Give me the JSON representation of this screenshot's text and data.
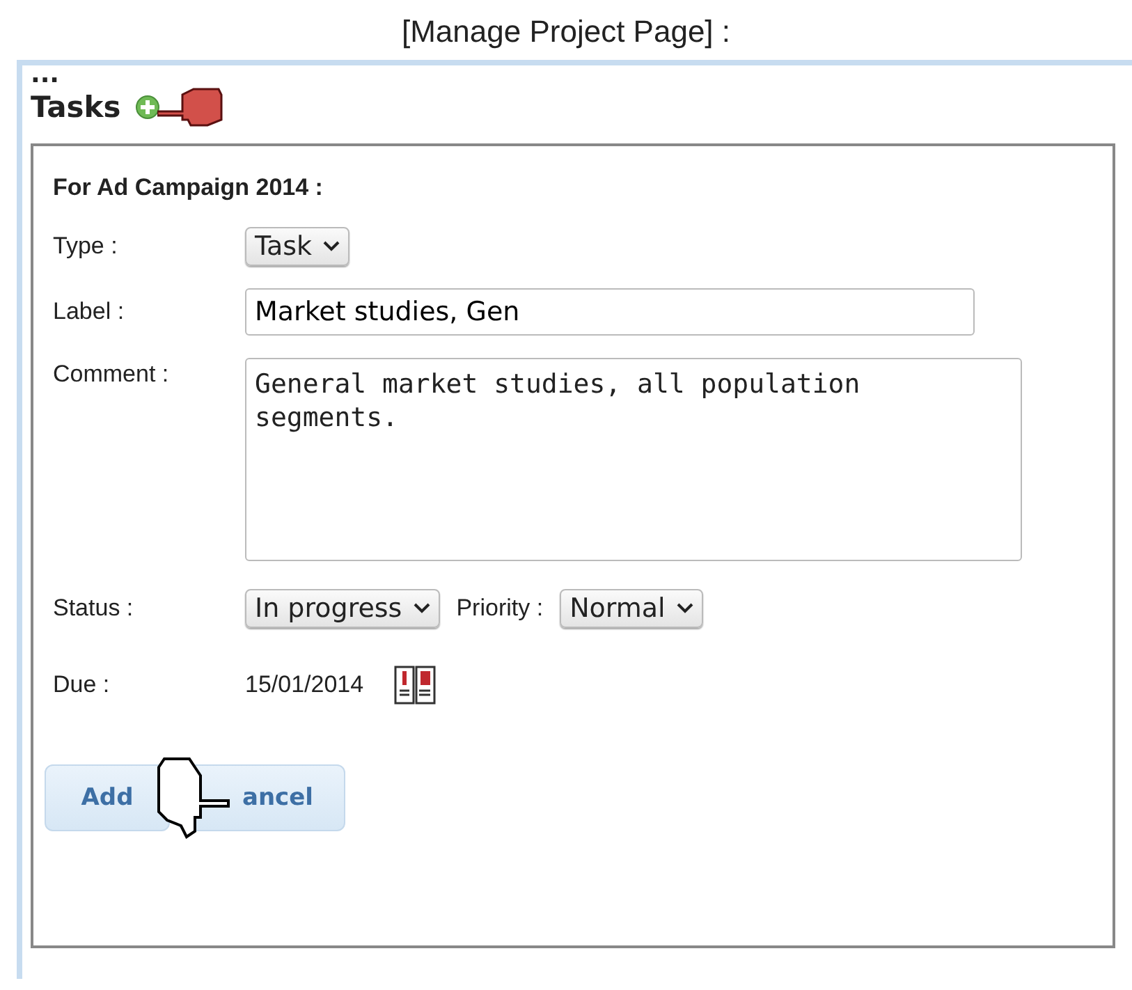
{
  "page_title": "[Manage Project Page] :",
  "ellipsis": "...",
  "section": {
    "title": "Tasks"
  },
  "form": {
    "heading": "For Ad Campaign 2014 :",
    "type": {
      "label": "Type :",
      "value": "Task"
    },
    "label_field": {
      "label": "Label :",
      "value": "Market studies, Gen"
    },
    "comment": {
      "label": "Comment :",
      "value": "General market studies, all population segments."
    },
    "status": {
      "label": "Status :",
      "value": "In progress"
    },
    "priority": {
      "label": "Priority :",
      "value": "Normal"
    },
    "due": {
      "label": "Due :",
      "value": "15/01/2014"
    },
    "buttons": [
      {
        "label": "Add"
      },
      {
        "label": "ancel"
      }
    ]
  }
}
